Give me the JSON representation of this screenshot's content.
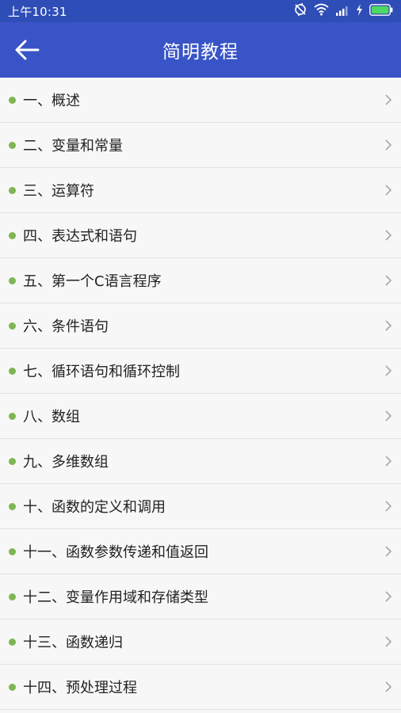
{
  "status_bar": {
    "time": "上午10:31",
    "icons": [
      "sync-off-icon",
      "wifi-icon",
      "signal-icon",
      "charging-icon",
      "battery-icon"
    ]
  },
  "app_bar": {
    "back_icon": "arrow-left-icon",
    "title": "简明教程"
  },
  "colors": {
    "status_bar": "#2f4db6",
    "app_bar": "#3954c6",
    "dot": "#7fb654",
    "battery": "#4cd964"
  },
  "lessons": [
    {
      "label": "一、概述"
    },
    {
      "label": "二、变量和常量"
    },
    {
      "label": "三、运算符"
    },
    {
      "label": "四、表达式和语句"
    },
    {
      "label": "五、第一个C语言程序"
    },
    {
      "label": "六、条件语句"
    },
    {
      "label": "七、循环语句和循环控制"
    },
    {
      "label": "八、数组"
    },
    {
      "label": "九、多维数组"
    },
    {
      "label": "十、函数的定义和调用"
    },
    {
      "label": "十一、函数参数传递和值返回"
    },
    {
      "label": "十二、变量作用域和存储类型"
    },
    {
      "label": "十三、函数递归"
    },
    {
      "label": "十四、预处理过程"
    }
  ]
}
